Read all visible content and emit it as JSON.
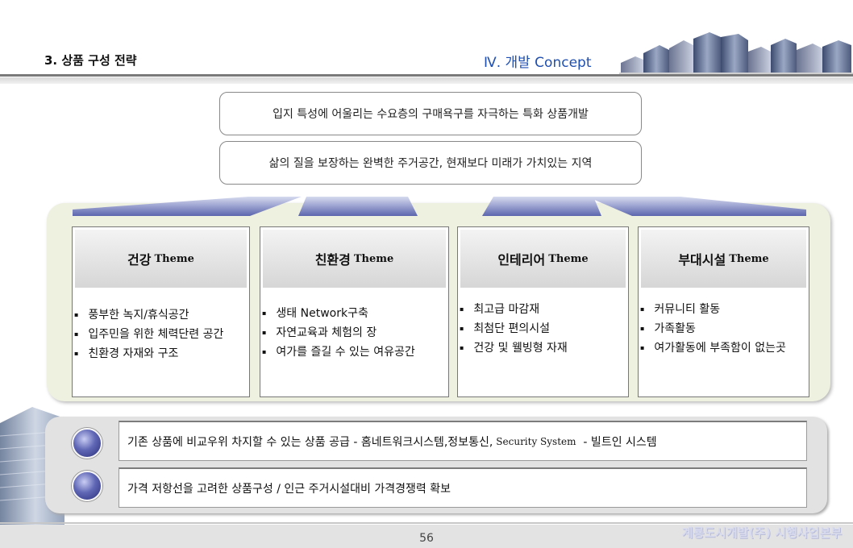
{
  "header": {
    "section_title": "3. 상품 구성 전략",
    "chapter_title": "Ⅳ.  개발 Concept"
  },
  "top_boxes": [
    "입지 특성에 어울리는 수요층의 구매욕구를 자극하는 특화 상품개발",
    "삶의 질을 보장하는 완벽한 주거공간, 현재보다 미래가 가치있는 지역"
  ],
  "themes": [
    {
      "title_ko": "건강",
      "title_en": "Theme",
      "items": [
        "풍부한 녹지/휴식공간",
        "입주민을 위한 체력단련 공간",
        "친환경 자재와 구조"
      ]
    },
    {
      "title_ko": "친환경",
      "title_en": "Theme",
      "items": [
        "생태 Network구축",
        "자연교육과 체험의 장",
        "여가를 즐길 수 있는 여유공간"
      ]
    },
    {
      "title_ko": "인테리어",
      "title_en": "Theme",
      "items": [
        "최고급 마감재",
        "최첨단 편의시설",
        "건강 및 웰빙형 자재"
      ]
    },
    {
      "title_ko": "부대시설",
      "title_en": "Theme",
      "items": [
        "커뮤니티 활동",
        "가족활동",
        "여가활동에 부족함이 없는곳"
      ]
    }
  ],
  "bottom": {
    "row1_a": "기존 상품에 비교우위 차지할 수 있는 상품 공급  - 홈네트워크시스템,정보통신,",
    "row1_b": "Security System",
    "row1_c": "  - 빌트인 시스템",
    "row2": "가격 저항선을 고려한  상품구성 / 인근 주거시설대비 가격경쟁력 확보"
  },
  "footer": {
    "page_number": "56",
    "company": "계룡도시개발(주) 시행사업본부"
  },
  "colors": {
    "chapter_blue": "#1f4fb0",
    "panel_bg": "#eef0e0",
    "orb": "#4a50a0",
    "arrow": "#6a73b8"
  }
}
